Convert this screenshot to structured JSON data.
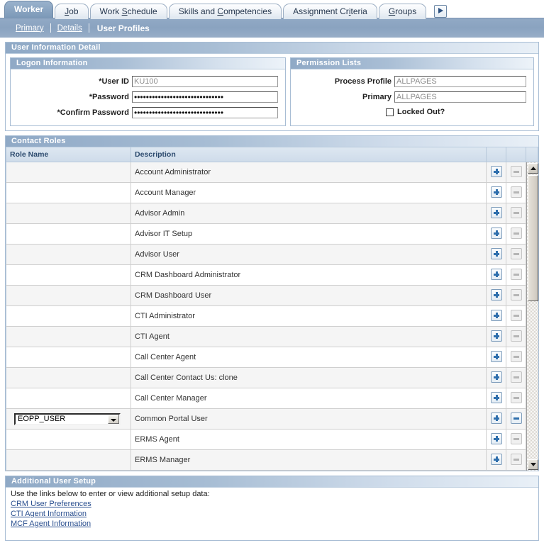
{
  "tabs": [
    {
      "label": "Worker",
      "accel": "",
      "active": true
    },
    {
      "label": "Job",
      "accel": "J",
      "active": false
    },
    {
      "label": "Work Schedule",
      "accel": "S",
      "active": false
    },
    {
      "label": "Skills and Competencies",
      "accel": "C",
      "active": false
    },
    {
      "label": "Assignment Criteria",
      "accel": "i",
      "active": false
    },
    {
      "label": "Groups",
      "accel": "G",
      "active": false
    }
  ],
  "tab_next_icon": "right-arrow-icon",
  "subnav": {
    "links": [
      "Primary",
      "Details"
    ],
    "current": "User Profiles"
  },
  "user_information_detail": {
    "title": "User Information Detail",
    "logon": {
      "title": "Logon Information",
      "fields": [
        {
          "label": "*User ID",
          "value": "KU100",
          "type": "text"
        },
        {
          "label": "*Password",
          "value": "••••••••••••••••••••••••••••••",
          "type": "password"
        },
        {
          "label": "*Confirm Password",
          "value": "••••••••••••••••••••••••••••••",
          "type": "password"
        }
      ]
    },
    "permission_lists": {
      "title": "Permission Lists",
      "fields": [
        {
          "label": "Process Profile",
          "value": "ALLPAGES"
        },
        {
          "label": "Primary",
          "value": "ALLPAGES"
        }
      ],
      "checkbox": {
        "label": "Locked Out?",
        "checked": false
      }
    }
  },
  "contact_roles": {
    "title": "Contact Roles",
    "columns": [
      "Role Name",
      "Description",
      "",
      "",
      ""
    ],
    "rows": [
      {
        "role_name": "",
        "description": "Account Administrator",
        "add_enabled": true,
        "remove_enabled": false
      },
      {
        "role_name": "",
        "description": "Account Manager",
        "add_enabled": true,
        "remove_enabled": false
      },
      {
        "role_name": "",
        "description": "Advisor Admin",
        "add_enabled": true,
        "remove_enabled": false
      },
      {
        "role_name": "",
        "description": "Advisor IT Setup",
        "add_enabled": true,
        "remove_enabled": false
      },
      {
        "role_name": "",
        "description": "Advisor User",
        "add_enabled": true,
        "remove_enabled": false
      },
      {
        "role_name": "",
        "description": "CRM Dashboard Administrator",
        "add_enabled": true,
        "remove_enabled": false
      },
      {
        "role_name": "",
        "description": "CRM Dashboard User",
        "add_enabled": true,
        "remove_enabled": false
      },
      {
        "role_name": "",
        "description": "CTI Administrator",
        "add_enabled": true,
        "remove_enabled": false
      },
      {
        "role_name": "",
        "description": "CTI Agent",
        "add_enabled": true,
        "remove_enabled": false
      },
      {
        "role_name": "",
        "description": "Call Center Agent",
        "add_enabled": true,
        "remove_enabled": false
      },
      {
        "role_name": "",
        "description": "Call Center Contact Us:  clone",
        "add_enabled": true,
        "remove_enabled": false
      },
      {
        "role_name": "",
        "description": "Call Center Manager",
        "add_enabled": true,
        "remove_enabled": false
      },
      {
        "role_name": "EOPP_USER",
        "description": "Common Portal User",
        "add_enabled": true,
        "remove_enabled": true,
        "has_select": true
      },
      {
        "role_name": "",
        "description": "ERMS Agent",
        "add_enabled": true,
        "remove_enabled": false
      },
      {
        "role_name": "",
        "description": "ERMS Manager",
        "add_enabled": true,
        "remove_enabled": false
      }
    ],
    "add_icon": "plus-icon",
    "remove_icon": "minus-icon",
    "scroll_up_icon": "scroll-up-arrow-icon",
    "scroll_down_icon": "scroll-down-arrow-icon"
  },
  "additional_user_setup": {
    "title": "Additional User Setup",
    "instruction": "Use the links below to enter or view additional setup data:",
    "links": [
      "CRM User Preferences",
      "CTI Agent Information",
      "MCF Agent Information"
    ]
  },
  "colors": {
    "accent": "#8aa3c0",
    "header_gradient_start": "#8fa9c6",
    "link": "#2a4f8f",
    "button_blue": "#2f6fad",
    "border": "#a8bdd4"
  }
}
